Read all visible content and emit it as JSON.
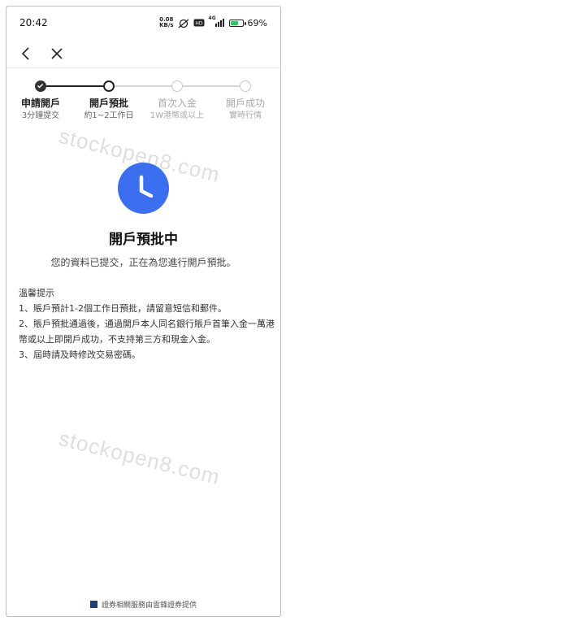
{
  "status_bar": {
    "time": "20:42",
    "net_speed_value": "0.08",
    "net_speed_unit": "KB/s",
    "signal_label": "4G",
    "battery_percent": "69%",
    "battery_level": 0.69
  },
  "nav": {
    "back_icon": "chevron-left-icon",
    "close_icon": "close-icon"
  },
  "steps": [
    {
      "title": "申請開戶",
      "subtitle": "3分鐘提交",
      "state": "done"
    },
    {
      "title": "開戶預批",
      "subtitle": "約1~2工作日",
      "state": "current"
    },
    {
      "title": "首次入金",
      "subtitle": "1W港幣或以上",
      "state": "future"
    },
    {
      "title": "開戶成功",
      "subtitle": "實時行情",
      "state": "future"
    }
  ],
  "watermark": "stockopen8.com",
  "status": {
    "icon": "clock-icon",
    "accent_color": "#3b6ff0",
    "title": "開戶預批中",
    "message": "您的資料已提交，正在為您進行開戶預批。"
  },
  "tips": {
    "heading": "溫馨提示",
    "items": [
      "1、賬戶預計1-2個工作日預批，請留意短信和郵件。",
      "2、賬戶預批通過後，通過開戶本人同名銀行賬戶首筆入金一萬港幣或以上即開戶成功，不支持第三方和現金入金。",
      "3、屆時請及時修改交易密碼。"
    ]
  },
  "footer": {
    "text": "證券相關服務由雲鋒證券提供"
  }
}
